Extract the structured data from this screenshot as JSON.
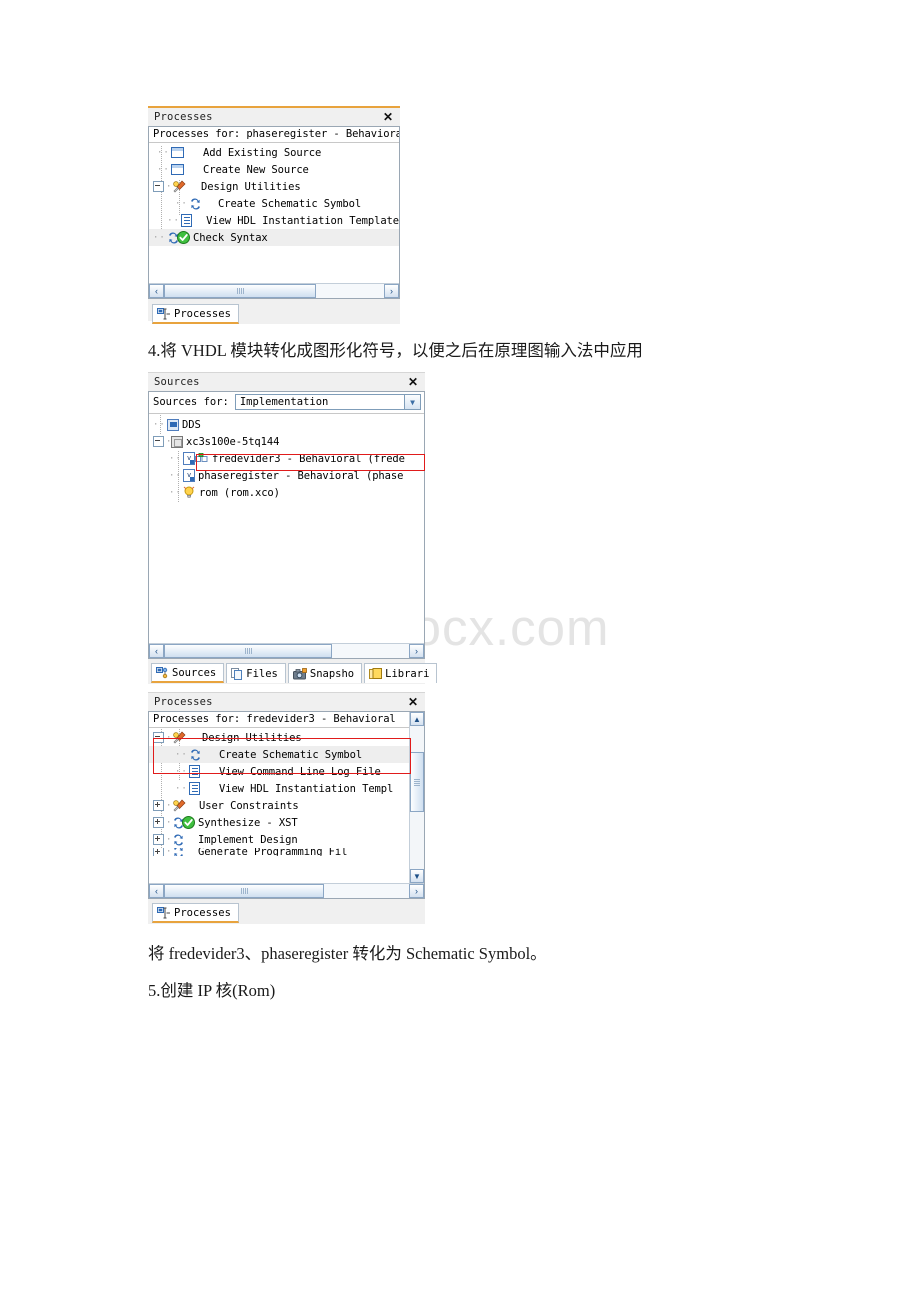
{
  "document": {
    "watermark": "www.bdocx.com",
    "paragraphs": [
      {
        "id": "p4",
        "text": "4.将 VHDL 模块转化成图形化符号，以便之后在原理图输入法中应用"
      },
      {
        "id": "p_convert",
        "text": "将 fredevider3、phaseregister 转化为 Schematic Symbol。"
      },
      {
        "id": "p5",
        "text": "5.创建 IP 核(Rom)"
      }
    ]
  },
  "processes_panel_1": {
    "title": "Processes",
    "close_label": "✕",
    "header": "Processes for: phaseregister - Behavioral",
    "tree": [
      {
        "label": "Add Existing Source",
        "icon": "blue-rect-icon",
        "indent": 1,
        "expander": "none"
      },
      {
        "label": "Create New Source",
        "icon": "blue-rect-icon",
        "indent": 1,
        "expander": "none"
      },
      {
        "label": "Design Utilities",
        "icon": "tool-icon",
        "indent": 0,
        "expander": "minus"
      },
      {
        "label": "Create Schematic Symbol",
        "icon": "process-icon",
        "indent": 2,
        "expander": "none"
      },
      {
        "label": "View HDL Instantiation Template",
        "icon": "document-icon",
        "indent": 2,
        "expander": "none"
      },
      {
        "label": "Check Syntax",
        "icon": "process-check-icon",
        "indent": 0,
        "expander": "none",
        "selected": true
      }
    ],
    "scroll": {
      "left_arrow": "‹",
      "right_arrow": "›"
    },
    "tabs": [
      {
        "label": "Processes",
        "icon": "processes-icon",
        "active": true
      }
    ]
  },
  "sources_panel": {
    "title": "Sources",
    "close_label": "✕",
    "sources_for_label": "Sources for:",
    "sources_for_value": "Implementation",
    "dropdown_arrow": "▼",
    "tree": [
      {
        "label": "DDS",
        "icon": "project-icon",
        "indent": 0,
        "expander": "none"
      },
      {
        "label": "xc3s100e-5tq144",
        "icon": "chip-icon",
        "indent": 0,
        "expander": "minus"
      },
      {
        "label": "fredevider3 - Behavioral (frede",
        "icon": "vhdl-module-icon",
        "indent": 1,
        "expander": "none",
        "highlighted": true
      },
      {
        "label": "phaseregister - Behavioral (phase",
        "icon": "vhdl-module-icon",
        "indent": 1,
        "expander": "none"
      },
      {
        "label": "rom (rom.xco)",
        "icon": "ipcore-icon",
        "indent": 1,
        "expander": "none"
      }
    ],
    "scroll": {
      "left_arrow": "‹",
      "right_arrow": "›"
    },
    "tabs": [
      {
        "label": "Sources",
        "icon": "sources-icon",
        "active": true
      },
      {
        "label": "Files",
        "icon": "files-icon",
        "active": false
      },
      {
        "label": "Snapsho",
        "icon": "snapshots-icon",
        "active": false
      },
      {
        "label": "Librari",
        "icon": "libraries-icon",
        "active": false
      }
    ]
  },
  "processes_panel_2": {
    "title": "Processes",
    "close_label": "✕",
    "header": "Processes for: fredevider3 - Behavioral",
    "tree": [
      {
        "label": "Design Utilities",
        "icon": "tool-icon",
        "indent": 0,
        "expander": "minus",
        "highlighted": true
      },
      {
        "label": "Create Schematic Symbol",
        "icon": "process-icon",
        "indent": 1,
        "expander": "none",
        "selected": true,
        "highlighted": true
      },
      {
        "label": "View Command Line Log File",
        "icon": "document-icon",
        "indent": 1,
        "expander": "none"
      },
      {
        "label": "View HDL Instantiation Templ",
        "icon": "document-icon",
        "indent": 1,
        "expander": "none"
      },
      {
        "label": "User Constraints",
        "icon": "tool-icon",
        "indent": 0,
        "expander": "plus"
      },
      {
        "label": "Synthesize - XST",
        "icon": "process-check-icon",
        "indent": 0,
        "expander": "plus"
      },
      {
        "label": "Implement Design",
        "icon": "process-icon",
        "indent": 0,
        "expander": "plus"
      },
      {
        "label": "Generate Programming Fil",
        "icon": "process-icon",
        "indent": 0,
        "expander": "plus",
        "clipped": true
      }
    ],
    "scroll": {
      "left_arrow": "‹",
      "right_arrow": "›",
      "up_arrow": "▲",
      "down_arrow": "▼"
    },
    "tabs": [
      {
        "label": "Processes",
        "icon": "processes-icon",
        "active": true
      }
    ]
  },
  "colors": {
    "accent_orange": "#e8a33d",
    "highlight_red": "#e01b1b",
    "panel_bg": "#f0f0f0",
    "selection_gray": "#eeeeee",
    "border_blue_gray": "#9aa7b4",
    "icon_blue": "#2f6ab5",
    "icon_green": "#2faa2f"
  }
}
